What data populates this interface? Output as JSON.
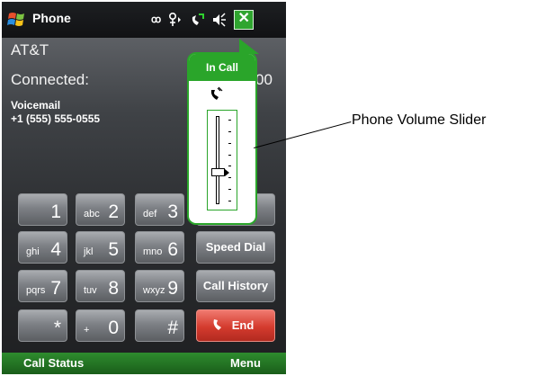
{
  "titlebar": {
    "title": "Phone",
    "icons": [
      "windows-start-logo",
      "voicemail-icon",
      "signal-icon",
      "call-active-icon",
      "speaker-icon",
      "close-icon"
    ],
    "voicemail_glyph": "ꝏ",
    "close_label": "✕"
  },
  "call": {
    "carrier": "AT&T",
    "connected_label": "Connected:",
    "connected_time": "00",
    "contact_label": "Voicemail",
    "contact_number": "+1 (555) 555-0555"
  },
  "keypad": {
    "keys": [
      {
        "sub": "",
        "main": "1"
      },
      {
        "sub": "abc",
        "main": "2"
      },
      {
        "sub": "def",
        "main": "3"
      },
      {
        "sub": "ghi",
        "main": "4"
      },
      {
        "sub": "jkl",
        "main": "5"
      },
      {
        "sub": "mno",
        "main": "6"
      },
      {
        "sub": "pqrs",
        "main": "7"
      },
      {
        "sub": "tuv",
        "main": "8"
      },
      {
        "sub": "wxyz",
        "main": "9"
      },
      {
        "sub": "",
        "main": "*"
      },
      {
        "sub": "+",
        "main": "0"
      },
      {
        "sub": "",
        "main": "#"
      }
    ],
    "speed_dial": "Speed Dial",
    "call_history": "Call History",
    "end": "End"
  },
  "softkeys": {
    "left": "Call Status",
    "right": "Menu"
  },
  "volume_popup": {
    "title": "In Call",
    "level": 0.36,
    "tick_count": 8
  },
  "callout": {
    "label": "Phone Volume Slider"
  },
  "colors": {
    "accent_green": "#2aa52a",
    "end_red": "#d43b2e"
  }
}
